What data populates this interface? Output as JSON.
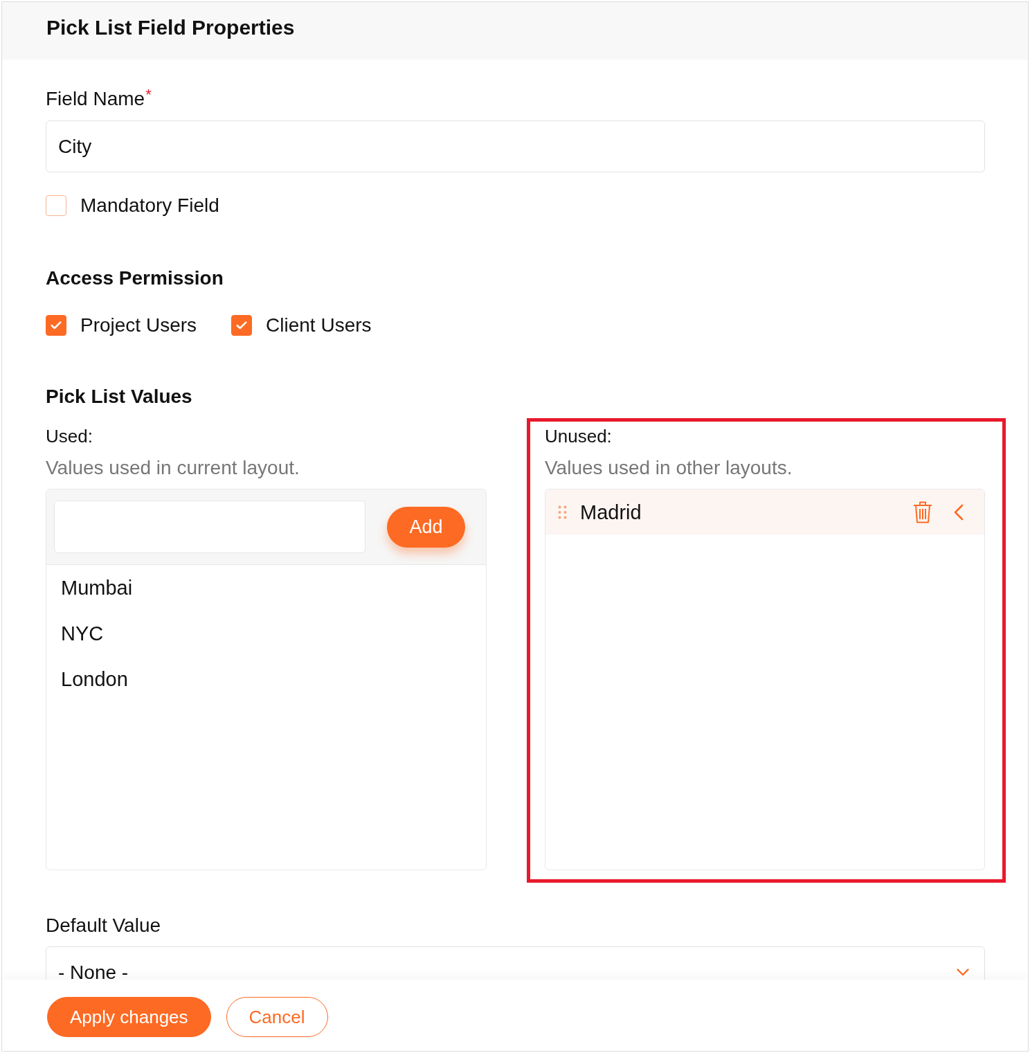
{
  "dialog": {
    "title": "Pick List Field Properties"
  },
  "field_name": {
    "label": "Field Name",
    "required_mark": "*",
    "value": "City"
  },
  "mandatory_field": {
    "label": "Mandatory Field",
    "checked": false
  },
  "access_permission": {
    "heading": "Access Permission",
    "options": [
      {
        "label": "Project Users",
        "checked": true
      },
      {
        "label": "Client Users",
        "checked": true
      }
    ]
  },
  "pick_list_values": {
    "heading": "Pick List Values",
    "used": {
      "label": "Used:",
      "description": "Values used in current layout.",
      "add_button": "Add",
      "items": [
        "Mumbai",
        "NYC",
        "London"
      ]
    },
    "unused": {
      "label": "Unused:",
      "description": "Values used in other layouts.",
      "highlighted": true,
      "items": [
        "Madrid"
      ]
    }
  },
  "default_value": {
    "label": "Default Value",
    "value": "- None -"
  },
  "buttons": [
    {
      "label": "Apply changes",
      "kind": "primary"
    },
    {
      "label": "Cancel",
      "kind": "secondary"
    }
  ]
}
